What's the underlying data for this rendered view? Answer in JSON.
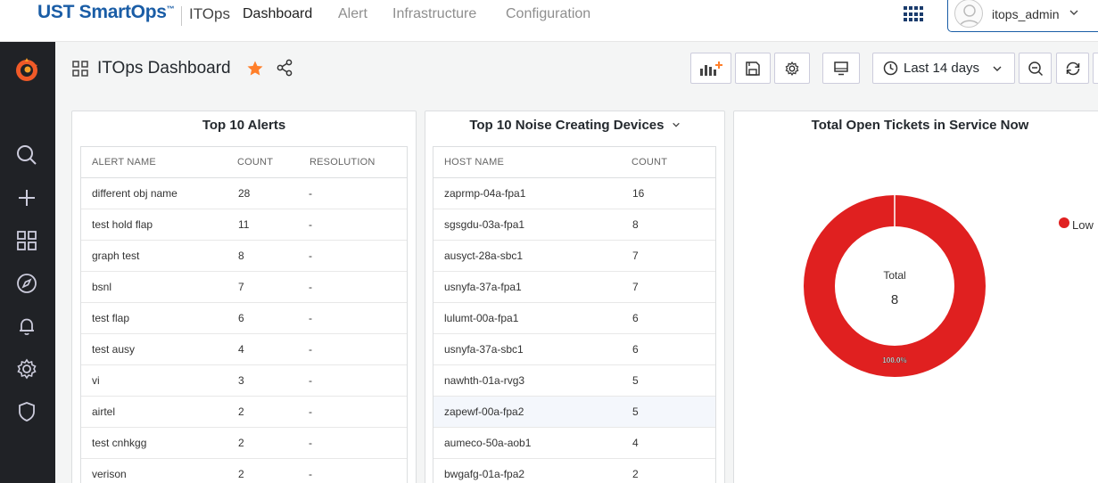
{
  "brand": {
    "name": "UST SmartOps",
    "tm": "™"
  },
  "app_name": "ITOps",
  "nav": [
    "Dashboard",
    "Alert",
    "Infrastructure",
    "Configuration"
  ],
  "user": {
    "name": "itops_admin"
  },
  "dashboard": {
    "title": "ITOps Dashboard",
    "time_range": "Last 14 days"
  },
  "panels": {
    "alerts": {
      "title": "Top 10 Alerts",
      "headers": [
        "ALERT NAME",
        "COUNT",
        "RESOLUTION"
      ],
      "rows": [
        [
          "different obj name",
          "28",
          "-"
        ],
        [
          "test hold flap",
          "11",
          "-"
        ],
        [
          "graph test",
          "8",
          "-"
        ],
        [
          "bsnl",
          "7",
          "-"
        ],
        [
          "test flap",
          "6",
          "-"
        ],
        [
          "test ausy",
          "4",
          "-"
        ],
        [
          "vi",
          "3",
          "-"
        ],
        [
          "airtel",
          "2",
          "-"
        ],
        [
          "test cnhkgg",
          "2",
          "-"
        ],
        [
          "verison",
          "2",
          "-"
        ]
      ]
    },
    "devices": {
      "title": "Top 10 Noise Creating Devices",
      "headers": [
        "HOST NAME",
        "COUNT"
      ],
      "rows": [
        [
          "zaprmp-04a-fpa1",
          "16"
        ],
        [
          "sgsgdu-03a-fpa1",
          "8"
        ],
        [
          "ausyct-28a-sbc1",
          "7"
        ],
        [
          "usnyfa-37a-fpa1",
          "7"
        ],
        [
          "lulumt-00a-fpa1",
          "6"
        ],
        [
          "usnyfa-37a-sbc1",
          "6"
        ],
        [
          "nawhth-01a-rvg3",
          "5"
        ],
        [
          "zapewf-00a-fpa2",
          "5"
        ],
        [
          "aumeco-50a-aob1",
          "4"
        ],
        [
          "bwgafg-01a-fpa2",
          "2"
        ]
      ]
    },
    "tickets": {
      "title": "Total Open Tickets in Service Now",
      "total_label": "Total",
      "total_value": "8",
      "legend": [
        "Low"
      ],
      "colors": {
        "low": "#e02020"
      }
    }
  },
  "chart_data": {
    "type": "pie",
    "title": "Total Open Tickets in Service Now",
    "categories": [
      "Low"
    ],
    "values": [
      8
    ],
    "slice_labels": [
      "100.0%"
    ],
    "center_label": "Total",
    "center_value": "8",
    "legend_placement": "right"
  }
}
